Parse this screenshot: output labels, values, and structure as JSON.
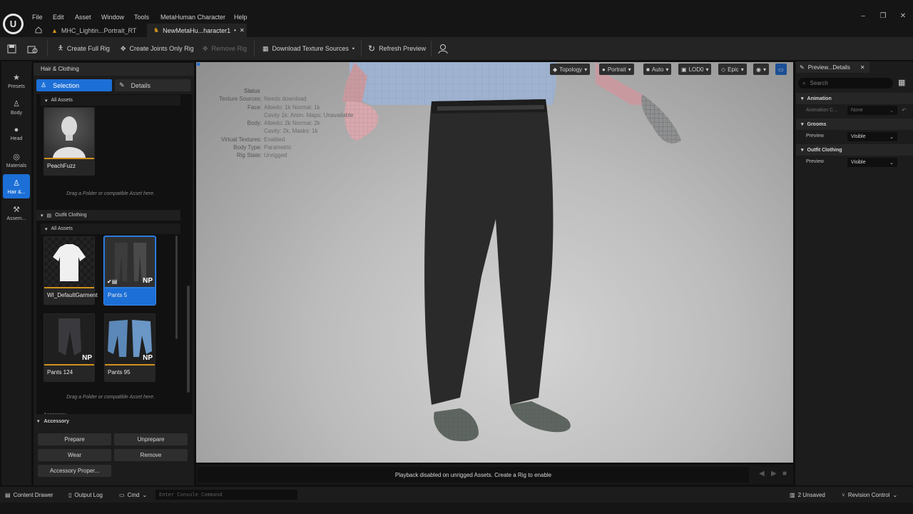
{
  "menu": [
    "File",
    "Edit",
    "Asset",
    "Window",
    "Tools",
    "MetaHuman Character",
    "Help"
  ],
  "tabs": {
    "tab1": "MHC_Lightin...Portrait_RT",
    "tab2": "NewMetaHu...haracter1"
  },
  "toolbar": {
    "create_full_rig": "Create Full Rig",
    "create_joints_only_rig": "Create Joints Only Rig",
    "remove_rig": "Remove Rig",
    "download_texture_sources": "Download Texture Sources",
    "refresh_preview": "Refresh Preview"
  },
  "nav": {
    "presets": "Presets",
    "body": "Body",
    "head": "Head",
    "materials": "Materials",
    "hair": "Hair &...",
    "assembly": "Assem..."
  },
  "panel": {
    "title": "Hair & Clothing",
    "selection_label": "Selection",
    "details_label": "Details",
    "all_assets_1": "All Assets",
    "peachfuzz": "PeachFuzz",
    "drag_hint_1": "Drag a Folder or compatible Asset here.",
    "outfit_clothing": "Outfit Clothing",
    "all_assets_2": "All Assets",
    "tiles": [
      "WI_DefaultGarment",
      "Pants 5",
      "Pants 124",
      "Pants 95"
    ],
    "np_badge": "NP",
    "drag_hint_2": "Drag a Folder or compatible Asset here.",
    "accessory_clipped": "Accessory",
    "accessory": "Accessory",
    "prepare": "Prepare",
    "unprepare": "Unprepare",
    "wear": "Wear",
    "remove": "Remove",
    "accessory_properties": "Accessory Proper..."
  },
  "viewport": {
    "topology": "Topology",
    "portrait": "Portrait",
    "auto": "Auto",
    "lod": "LOD0",
    "epic": "Epic",
    "status_title": "Status",
    "status_rows": [
      {
        "k": "Texture Sources:",
        "v": "Needs download"
      },
      {
        "k": "Face:",
        "v": "Albedo: 1k Normal: 1k"
      },
      {
        "k": "",
        "v": "Cavity 1k: Anim. Maps: Unavailable"
      },
      {
        "k": "Body:",
        "v": "Albedo: 2k Normal: 2k"
      },
      {
        "k": "",
        "v": "Cavity: 2k, Masks: 1k"
      },
      {
        "k": "Virtual Textures:",
        "v": "Enabled"
      },
      {
        "k": "Body Type:",
        "v": "Parametric"
      },
      {
        "k": "Rig State:",
        "v": "Unrigged"
      }
    ],
    "playback_msg": "Playback disabled on unrigged Assets. Create a Rig to enable"
  },
  "details": {
    "tab": "Preview...Details",
    "search_placeholder": "Search",
    "animation": "Animation",
    "animation_key": "Animation C...",
    "animation_value": "None",
    "grooms": "Grooms",
    "grooms_preview_key": "Preview",
    "grooms_preview_value": "Visible",
    "outfit": "Outfit Clothing",
    "outfit_preview_key": "Preview",
    "outfit_preview_value": "Visible"
  },
  "statusbar": {
    "content_drawer": "Content Drawer",
    "output_log": "Output Log",
    "cmd": "Cmd",
    "console_placeholder": "Enter Console Command",
    "unsaved": "2 Unsaved",
    "revision_control": "Revision Control"
  },
  "colors": {
    "accent": "#1c6fd6",
    "asset_bar": "#d1911e"
  }
}
